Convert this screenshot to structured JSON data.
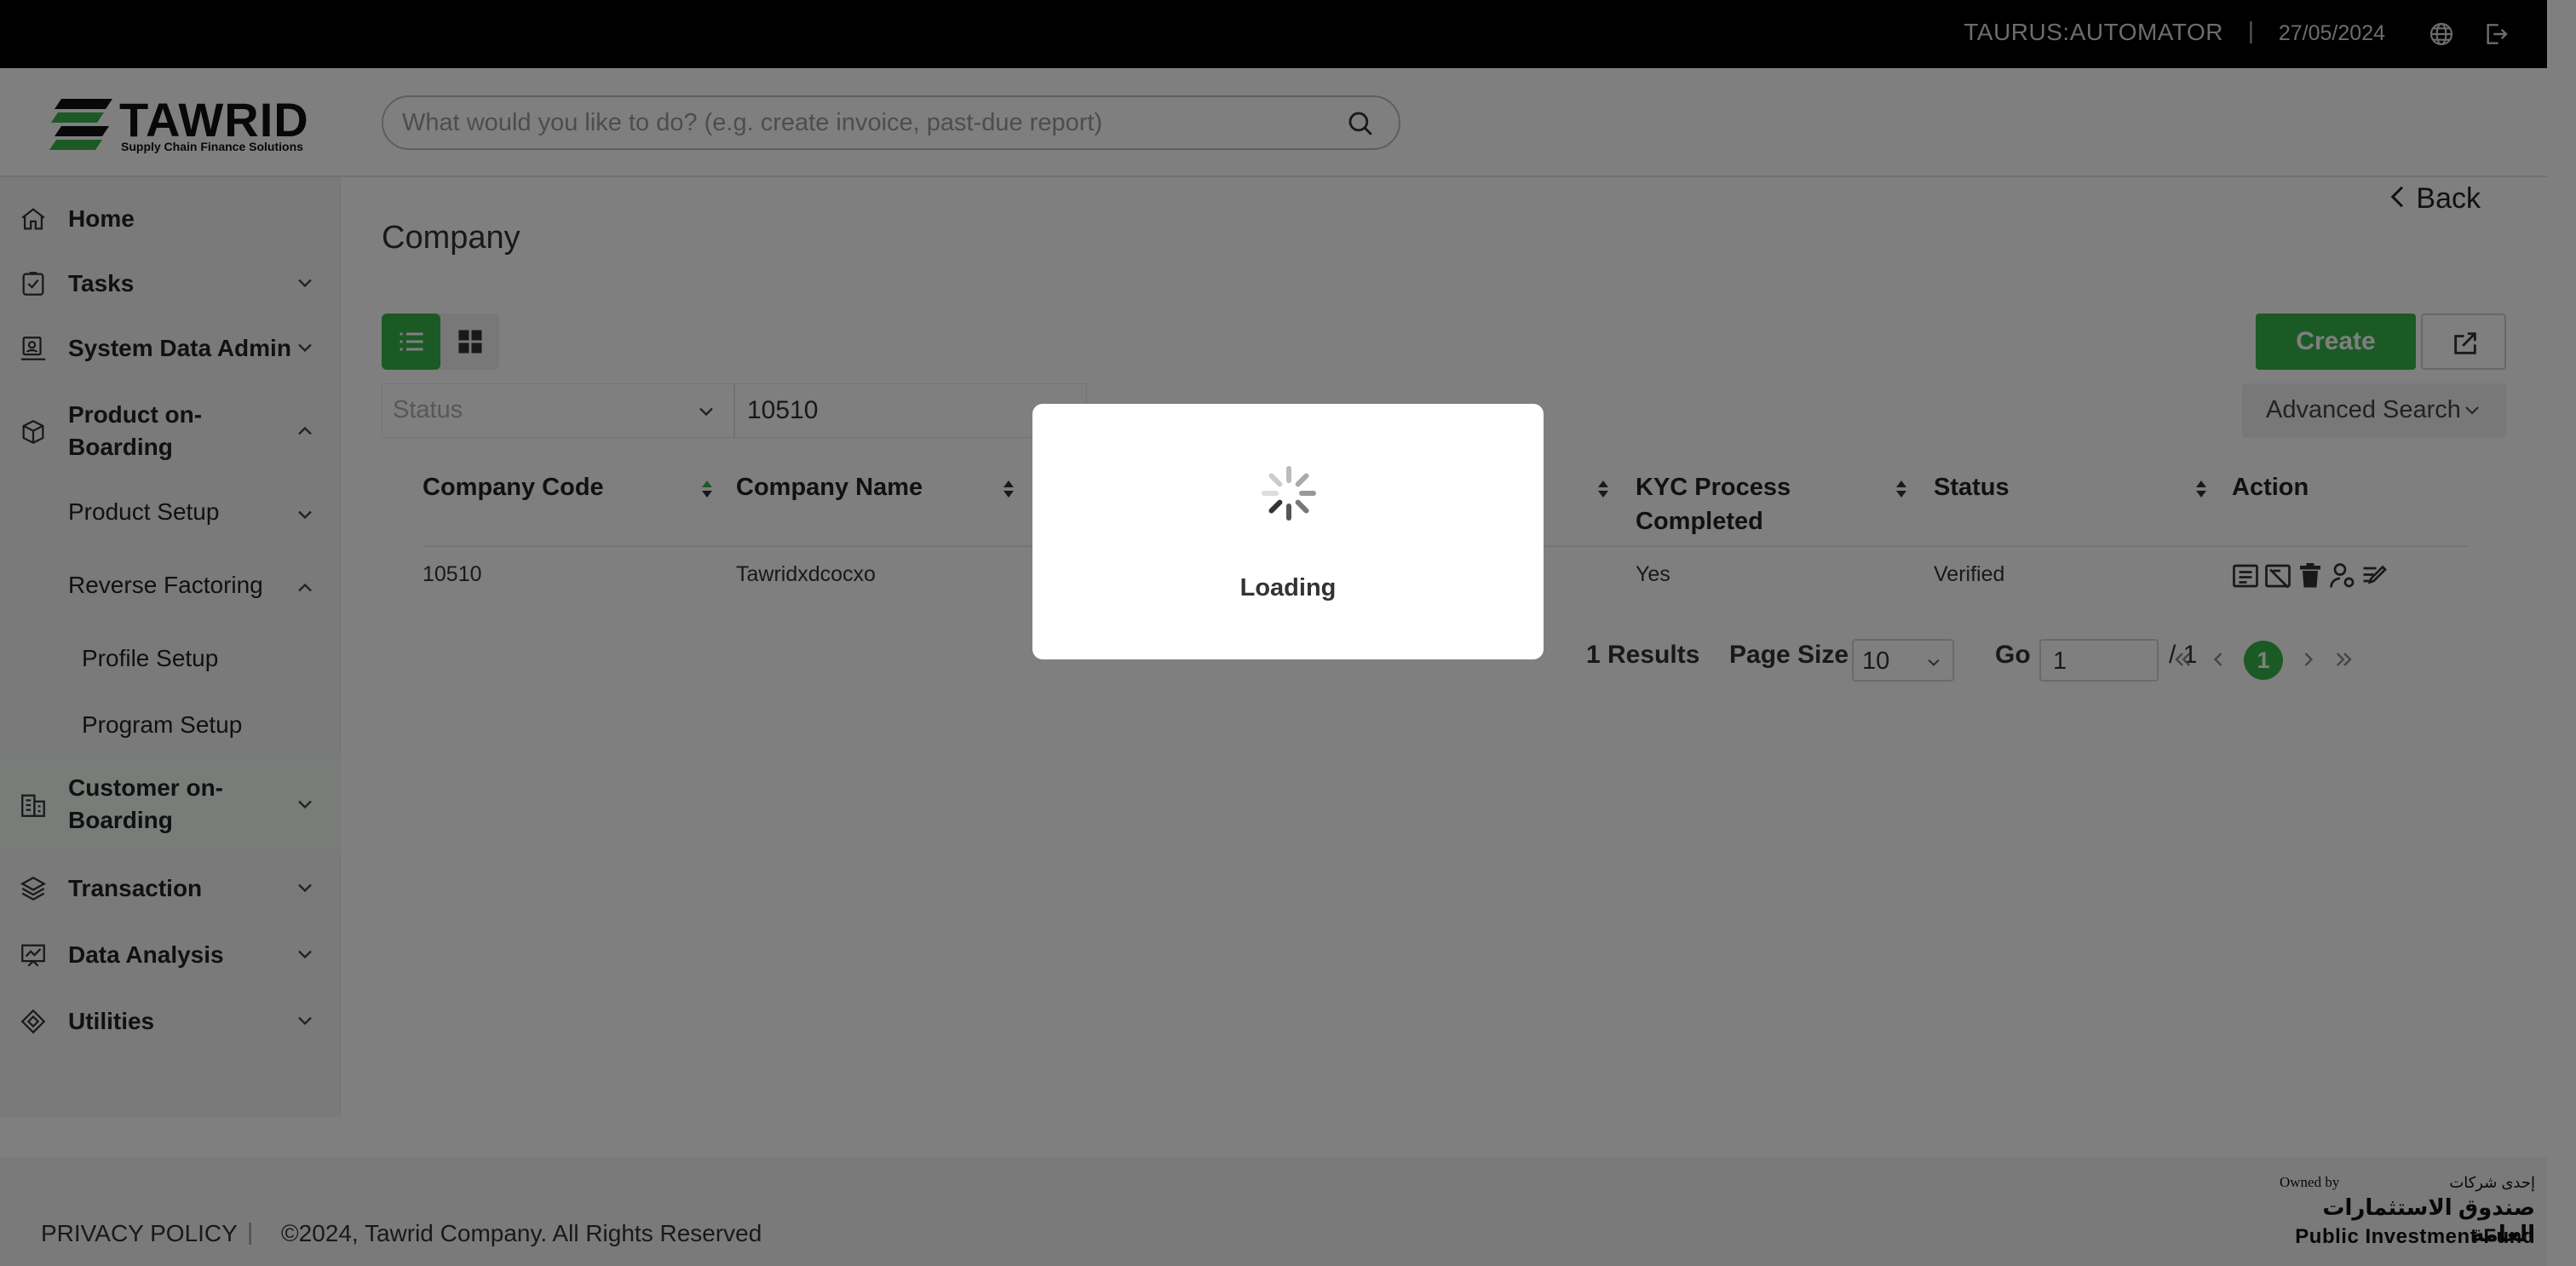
{
  "topbar": {
    "user": "TAURUS:AUTOMATOR",
    "separator": "|",
    "date": "27/05/2024",
    "icons": [
      "globe-icon",
      "logout-icon"
    ]
  },
  "header": {
    "logo_name": "TAWRID",
    "logo_tagline": "Supply Chain Finance Solutions",
    "search_placeholder": "What would you like to do? (e.g. create invoice, past-due report)"
  },
  "sidebar": {
    "items": [
      {
        "label": "Home",
        "icon": "home-icon"
      },
      {
        "label": "Tasks",
        "icon": "tasks-icon"
      },
      {
        "label": "System Data Admin",
        "icon": "admin-icon"
      },
      {
        "label": "Product on-\nBoarding",
        "icon": "box-icon"
      },
      {
        "label": "Product Setup"
      },
      {
        "label": "Reverse Factoring"
      },
      {
        "label": "Profile Setup"
      },
      {
        "label": "Program Setup"
      },
      {
        "label": "Customer on-\nBoarding",
        "icon": "building-icon"
      },
      {
        "label": "Transaction",
        "icon": "layers-icon"
      },
      {
        "label": "Data Analysis",
        "icon": "chart-icon"
      },
      {
        "label": "Utilities",
        "icon": "utilities-icon"
      }
    ]
  },
  "main": {
    "back_label": "Back",
    "page_title": "Company",
    "create_label": "Create",
    "filter_status_placeholder": "Status",
    "filter_code_value": "10510",
    "advanced_search_label": "Advanced Search"
  },
  "table": {
    "columns": [
      "Company Code",
      "Company Name",
      "KYC Process\nCompleted",
      "Status",
      "Action"
    ],
    "rows": [
      {
        "company_code": "10510",
        "company_name": "Tawridxdcocxo",
        "kyc": "Yes",
        "status": "Verified"
      }
    ],
    "action_icons": [
      "view-icon",
      "disable-icon",
      "delete-icon",
      "user-settings-icon",
      "edit-icon"
    ]
  },
  "pagination": {
    "results": "1 Results",
    "page_size_label": "Page Size",
    "page_size_value": "10",
    "go_label": "Go",
    "go_value": "1",
    "total_pages": "/ 1",
    "current_page": "1"
  },
  "footer": {
    "privacy": "PRIVACY POLICY",
    "separator": "|",
    "copyright": "©2024, Tawrid Company. All Rights Reserved",
    "owned_by": "Owned by",
    "owner_ar_small": "إحدى شركات",
    "owner_ar": "صندوق الاستثمارات العامة",
    "owner_en": "Public Investment Fund"
  },
  "modal": {
    "loading_text": "Loading"
  },
  "colors": {
    "accent": "#39b54a",
    "topbar": "#000000",
    "overlay": "rgba(0,0,0,0.5)"
  }
}
